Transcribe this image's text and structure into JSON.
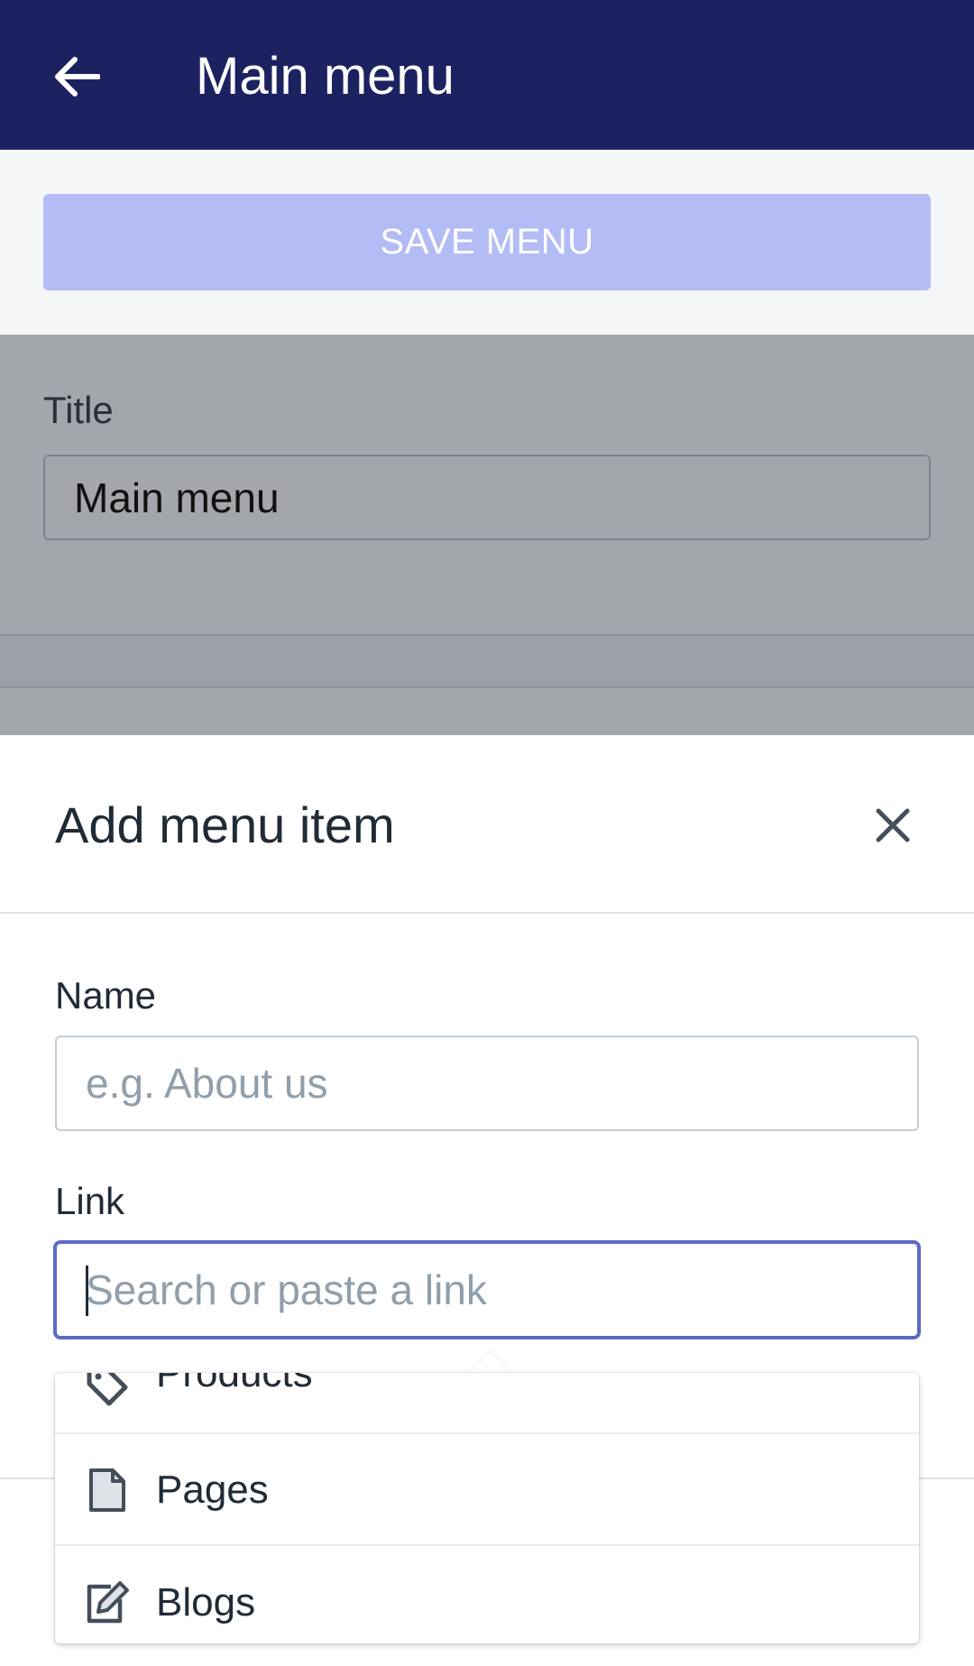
{
  "appbar": {
    "title": "Main menu",
    "back_icon": "arrow-left-icon"
  },
  "save_button": {
    "label": "SAVE MENU",
    "color": "#b3bcf5"
  },
  "form": {
    "title_label": "Title",
    "title_value": "Main menu"
  },
  "sheet": {
    "title": "Add menu item",
    "close_icon": "close-icon",
    "name_label": "Name",
    "name_placeholder": "e.g. About us",
    "link_label": "Link",
    "link_placeholder": "Search or paste a link",
    "focus_color": "#5c6ac4"
  },
  "dropdown": {
    "items": [
      {
        "label": "Products",
        "icon": "tag-icon"
      },
      {
        "label": "Pages",
        "icon": "page-icon"
      },
      {
        "label": "Blogs",
        "icon": "edit-icon"
      }
    ]
  },
  "colors": {
    "appbar": "#1c2260",
    "overlay": "#a3a6ab"
  }
}
